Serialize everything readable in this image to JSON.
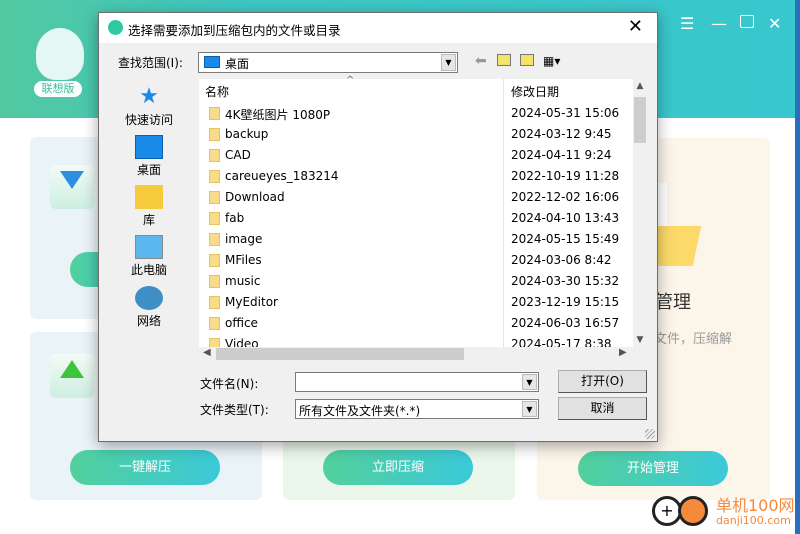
{
  "app": {
    "edition_badge": "联想版",
    "window_controls": [
      "menu-icon",
      "minimize-icon",
      "maximize-icon",
      "close-icon"
    ],
    "cards": [
      {
        "button": "一键解压"
      },
      {
        "button": "立即压缩"
      },
      {
        "title_partial": "管理",
        "desc_partial": "文件，压缩解",
        "button": "开始管理"
      }
    ]
  },
  "dialog": {
    "title": "选择需要添加到压缩包内的文件或目录",
    "look_in_label": "查找范围(I):",
    "look_in_value": "桌面",
    "places": [
      {
        "label": "快速访问",
        "icon": "star-icon"
      },
      {
        "label": "桌面",
        "icon": "desktop-icon"
      },
      {
        "label": "库",
        "icon": "library-icon"
      },
      {
        "label": "此电脑",
        "icon": "computer-icon"
      },
      {
        "label": "网络",
        "icon": "network-icon"
      }
    ],
    "columns": {
      "name": "名称",
      "date": "修改日期"
    },
    "files": [
      {
        "name": "4K壁纸图片 1080P",
        "date": "2024-05-31 15:06"
      },
      {
        "name": "backup",
        "date": "2024-03-12 9:45"
      },
      {
        "name": "CAD",
        "date": "2024-04-11 9:24"
      },
      {
        "name": "careueyes_183214",
        "date": "2022-10-19 11:28"
      },
      {
        "name": "Download",
        "date": "2022-12-02 16:06"
      },
      {
        "name": "fab",
        "date": "2024-04-10 13:43"
      },
      {
        "name": "image",
        "date": "2024-05-15 15:49"
      },
      {
        "name": "MFiles",
        "date": "2024-03-06 8:42"
      },
      {
        "name": "music",
        "date": "2024-03-30 15:32"
      },
      {
        "name": "MyEditor",
        "date": "2023-12-19 15:15"
      },
      {
        "name": "office",
        "date": "2024-06-03 16:57"
      },
      {
        "name": "Video",
        "date": "2024-05-17 8:38"
      }
    ],
    "filename_label": "文件名(N):",
    "filename_value": "",
    "filetype_label": "文件类型(T):",
    "filetype_value": "所有文件及文件夹(*.*)",
    "open_button": "打开(O)",
    "cancel_button": "取消"
  },
  "watermark": {
    "text": "单机100网",
    "url": "danji100.com"
  }
}
